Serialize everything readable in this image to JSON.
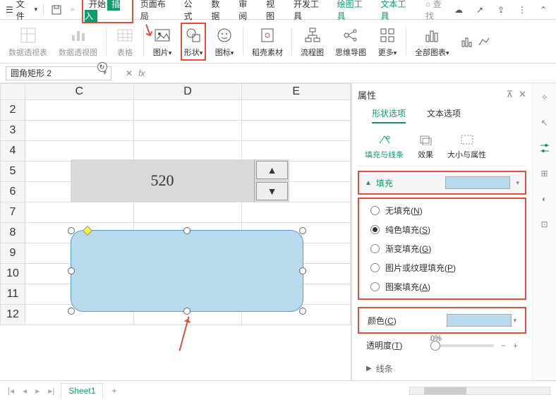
{
  "menubar": {
    "file": "文件",
    "tabs": [
      "开始",
      "插入",
      "页面布局",
      "公式",
      "数据",
      "审阅",
      "视图",
      "开发工具",
      "绘图工具",
      "文本工具"
    ],
    "active_tab_index": 1,
    "green_tab_indices": [
      8,
      9
    ],
    "search": "查找"
  },
  "ribbon": {
    "groups": [
      {
        "label": "数据透视表",
        "disabled": true
      },
      {
        "label": "数据透视图",
        "disabled": true
      },
      {
        "label": "表格",
        "disabled": true
      },
      {
        "label": "图片",
        "dropdown": true
      },
      {
        "label": "形状",
        "dropdown": true,
        "highlighted": true
      },
      {
        "label": "图标",
        "dropdown": true
      },
      {
        "label": "稻壳素材"
      },
      {
        "label": "流程图"
      },
      {
        "label": "思维导图"
      },
      {
        "label": "更多",
        "dropdown": true
      },
      {
        "label": "全部图表",
        "dropdown": true
      }
    ]
  },
  "name_box": "圆角矩形 2",
  "formula_bar": {
    "fx": "fx"
  },
  "sheet": {
    "columns": [
      "C",
      "D",
      "E"
    ],
    "rows": [
      "2",
      "3",
      "4",
      "5",
      "6",
      "7",
      "8",
      "9",
      "10",
      "11",
      "12"
    ],
    "spinner_value": "520",
    "tab_name": "Sheet1"
  },
  "props": {
    "title": "属性",
    "tabs": [
      "形状选项",
      "文本选项"
    ],
    "active_tab": 0,
    "subtabs": [
      "填充与线条",
      "效果",
      "大小与属性"
    ],
    "active_subtab": 0,
    "fill": {
      "header": "填充",
      "options": [
        {
          "label": "无填充",
          "key": "N"
        },
        {
          "label": "纯色填充",
          "key": "S",
          "checked": true
        },
        {
          "label": "渐变填充",
          "key": "G"
        },
        {
          "label": "图片或纹理填充",
          "key": "P"
        },
        {
          "label": "图案填充",
          "key": "A"
        }
      ],
      "color_label": "颜色",
      "color_key": "C",
      "opacity_label": "透明度",
      "opacity_key": "T",
      "opacity_value": "0%"
    },
    "line_header": "线条"
  },
  "chart_data": null
}
